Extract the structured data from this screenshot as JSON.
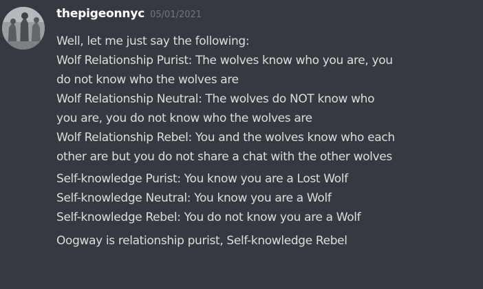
{
  "message": {
    "username": "thepigeonnyc",
    "timestamp": "05/01/2021",
    "lines": [
      "Well, let me just say the following:",
      "Wolf Relationship Purist: The wolves know who you are, you",
      "do not know who the wolves are",
      "Wolf Relationship Neutral: The wolves do NOT know who",
      "you are, you do not know who the wolves are",
      "Wolf Relationship Rebel: You and the wolves know who each",
      "other are but you do not share a chat with the other wolves",
      "Self-knowledge Purist: You know you are a Lost Wolf",
      "Self-knowledge Neutral: You know you are a Wolf",
      "Self-knowledge Rebel: You do not know you are a Wolf",
      "Oogway is relationship purist, Self-knowledge Rebel"
    ]
  },
  "avatar_icon": "user-avatar-icon",
  "colors": {
    "background": "#36393f",
    "username": "#ffffff",
    "timestamp": "#72767d",
    "text": "#dcddde"
  }
}
